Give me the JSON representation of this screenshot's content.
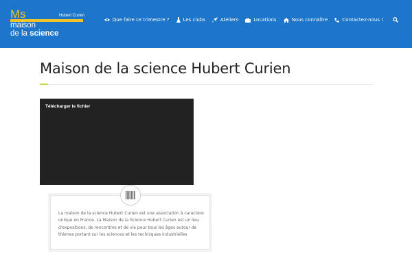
{
  "header": {
    "logo": {
      "ms": "Ms",
      "subtitle": "Hubert Curien",
      "line1": "maison",
      "line2_prefix": "de la ",
      "line2_bold": "science"
    },
    "nav": [
      {
        "label": "Que faire ce trimestre ?",
        "icon": "eye-icon"
      },
      {
        "label": "Les clubs",
        "icon": "flask-icon"
      },
      {
        "label": "Ateliers",
        "icon": "rocket-icon"
      },
      {
        "label": "Locations",
        "icon": "briefcase-icon"
      },
      {
        "label": "Nous connaître",
        "icon": "home-icon"
      },
      {
        "label": "Contactez-nous !",
        "icon": "phone-icon"
      }
    ],
    "search_icon": "search-icon"
  },
  "main": {
    "title": "Maison de la science Hubert Curien",
    "document": {
      "download_label": "Télécharger le fichier"
    },
    "card": {
      "icon": "barcode-icon",
      "text": "La maison de la science Hubert Curien est une association à caractère unique en France. La Maison de la Science Hubert Curien est un lieu d'expositions, de rencontres et de vie pour tous les âges autour de thèmes portant sur les sciences et les techniques industrielles"
    }
  },
  "colors": {
    "header_bg": "#1d76c9",
    "logo_yellow": "#f2c326",
    "accent_green": "#c7d63c",
    "viewer_bg": "#222222"
  }
}
